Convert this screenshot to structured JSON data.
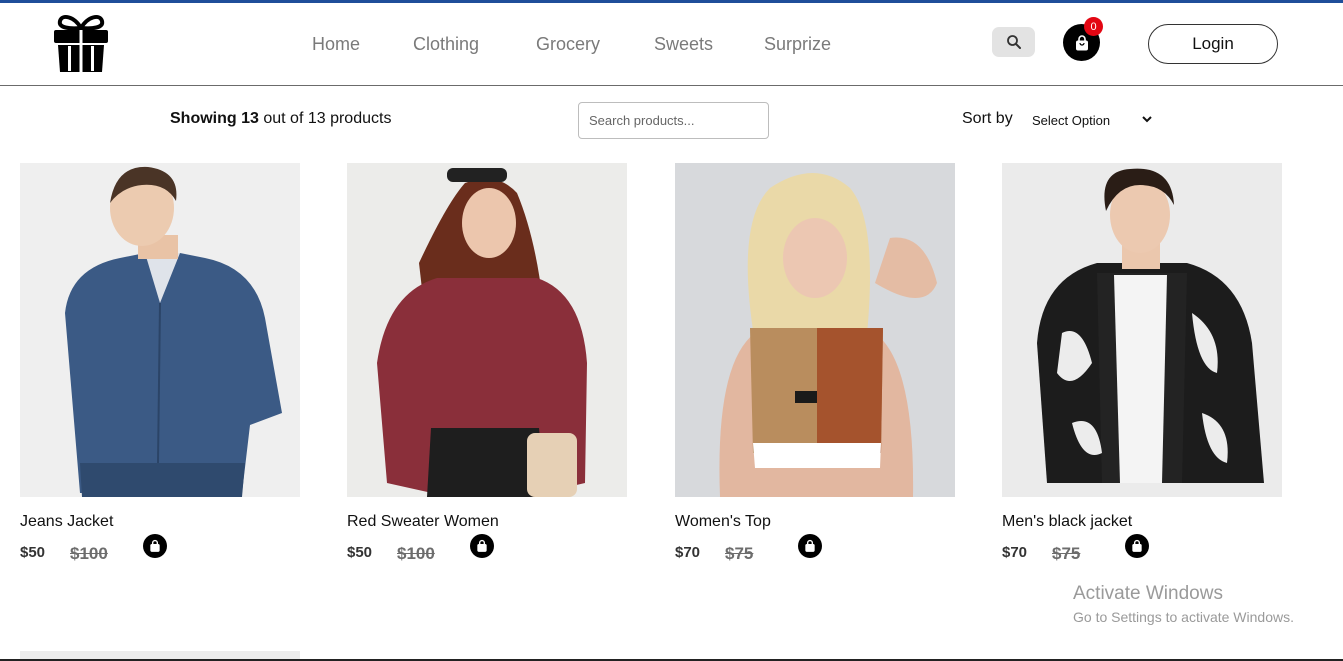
{
  "header": {
    "nav": [
      {
        "label": "Home"
      },
      {
        "label": "Clothing"
      },
      {
        "label": "Grocery"
      },
      {
        "label": "Sweets"
      },
      {
        "label": "Surprize"
      }
    ],
    "cart_count": "0",
    "login_label": "Login",
    "icons": {
      "logo": "gift-box-icon",
      "search": "search-icon",
      "cart": "shopping-bag-icon"
    }
  },
  "toolbar": {
    "showing_prefix": "Showing",
    "showing_count": "13",
    "showing_suffix": "out of 13 products",
    "search_placeholder": "Search products...",
    "sort_label": "Sort by",
    "sort_selected": "Select Option"
  },
  "products": [
    {
      "name": "Jeans Jacket",
      "price": "$50",
      "old_price": "$100"
    },
    {
      "name": "Red Sweater Women",
      "price": "$50",
      "old_price": "$100"
    },
    {
      "name": "Women's Top",
      "price": "$70",
      "old_price": "$75"
    },
    {
      "name": "Men's black jacket",
      "price": "$70",
      "old_price": "$75"
    }
  ],
  "watermark": {
    "title": "Activate Windows",
    "subtitle": "Go to Settings to activate Windows."
  },
  "colors": {
    "accent_bar": "#1f4e9a",
    "badge": "#e30613",
    "nav_text": "#7a7a7a"
  }
}
